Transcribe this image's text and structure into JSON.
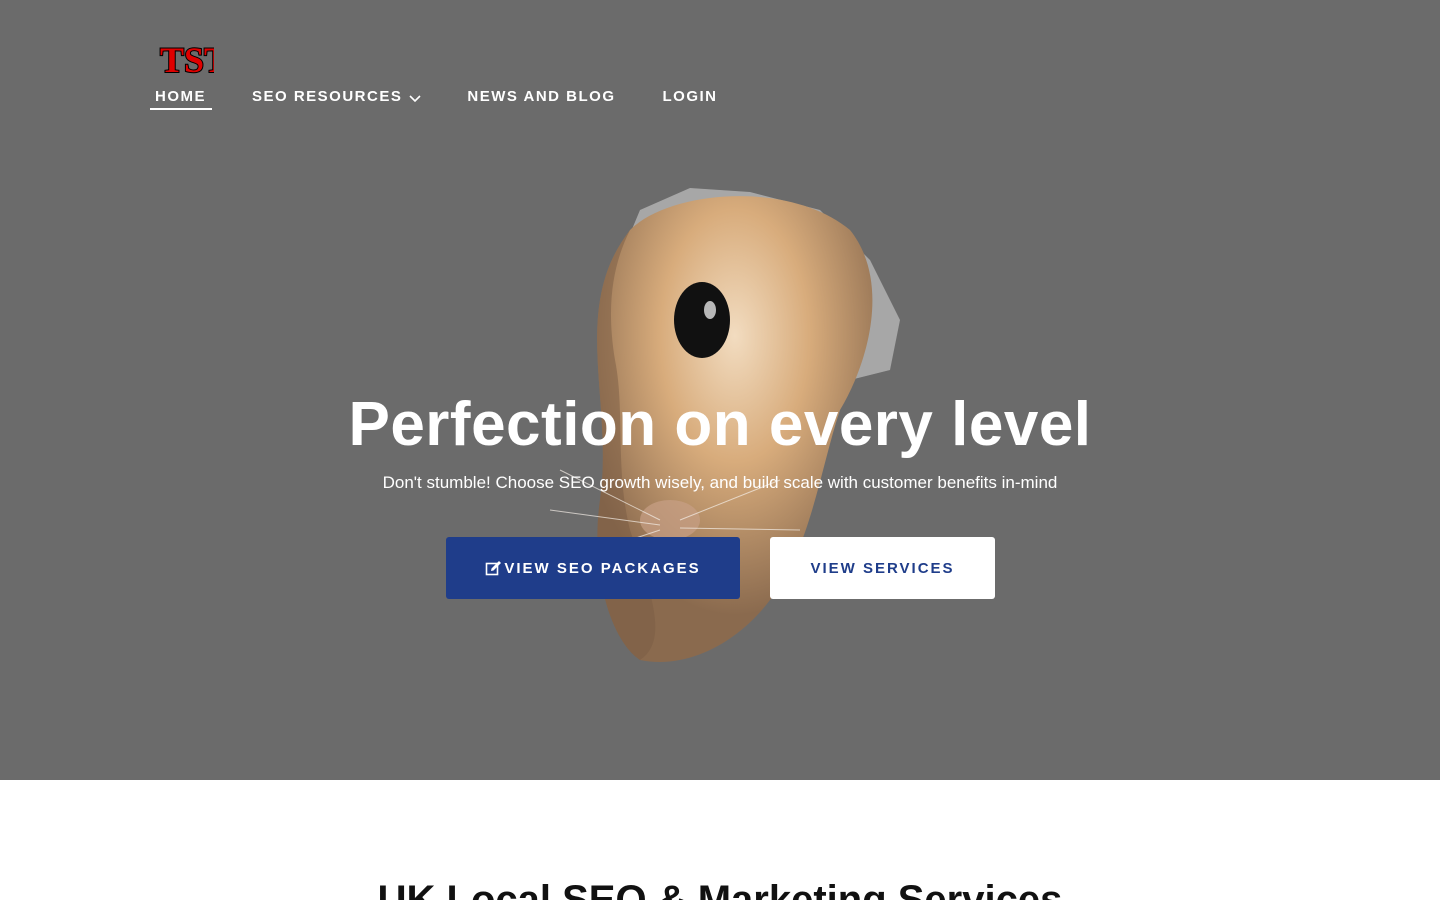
{
  "brand": {
    "logo_text": "TST",
    "logo_color": "#e00000"
  },
  "nav": {
    "items": [
      {
        "label": "HOME",
        "active": true
      },
      {
        "label": "SEO RESOURCES",
        "has_dropdown": true
      },
      {
        "label": "NEWS AND BLOG"
      },
      {
        "label": "LOGIN"
      }
    ]
  },
  "hero": {
    "background_color": "#6b6b6b",
    "image": "hamster-peeking-through-torn-paper",
    "title": "Perfection on every level",
    "subtitle": "Don't stumble! Choose SEO growth wisely, and build scale with customer benefits in-mind",
    "primary_button": {
      "label": "VIEW SEO PACKAGES",
      "icon": "edit-icon",
      "color": "#1f3d8a"
    },
    "secondary_button": {
      "label": "VIEW SERVICES"
    }
  },
  "section": {
    "title": "UK Local SEO & Marketing Services"
  }
}
